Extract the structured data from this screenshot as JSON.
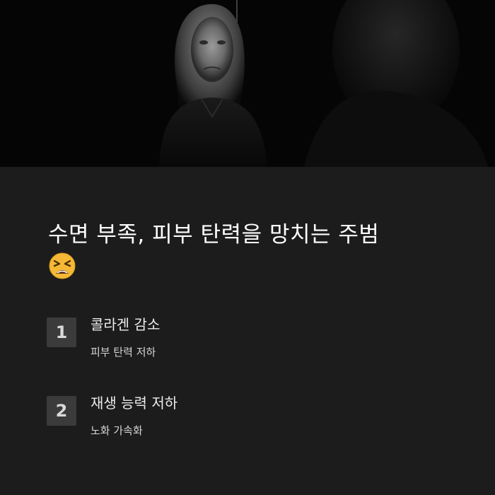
{
  "hero": {
    "image": "dark photo of an elderly woman in black clothing with a distressed expression, facing a dark mirror reflection"
  },
  "headline": {
    "title": "수면 부족, 피부 탄력을 망치는 주범",
    "emoji_icon": "tired-face-emoji-icon"
  },
  "items": [
    {
      "number": "1",
      "title": "콜라겐 감소",
      "subtitle": "피부 탄력 저하"
    },
    {
      "number": "2",
      "title": "재생 능력 저하",
      "subtitle": "노화 가속화"
    }
  ],
  "colors": {
    "background": "#1c1c1c",
    "hero_background": "#050505",
    "number_box": "#3b3b3b",
    "text": "#ffffff",
    "emoji": "#f5b836"
  }
}
